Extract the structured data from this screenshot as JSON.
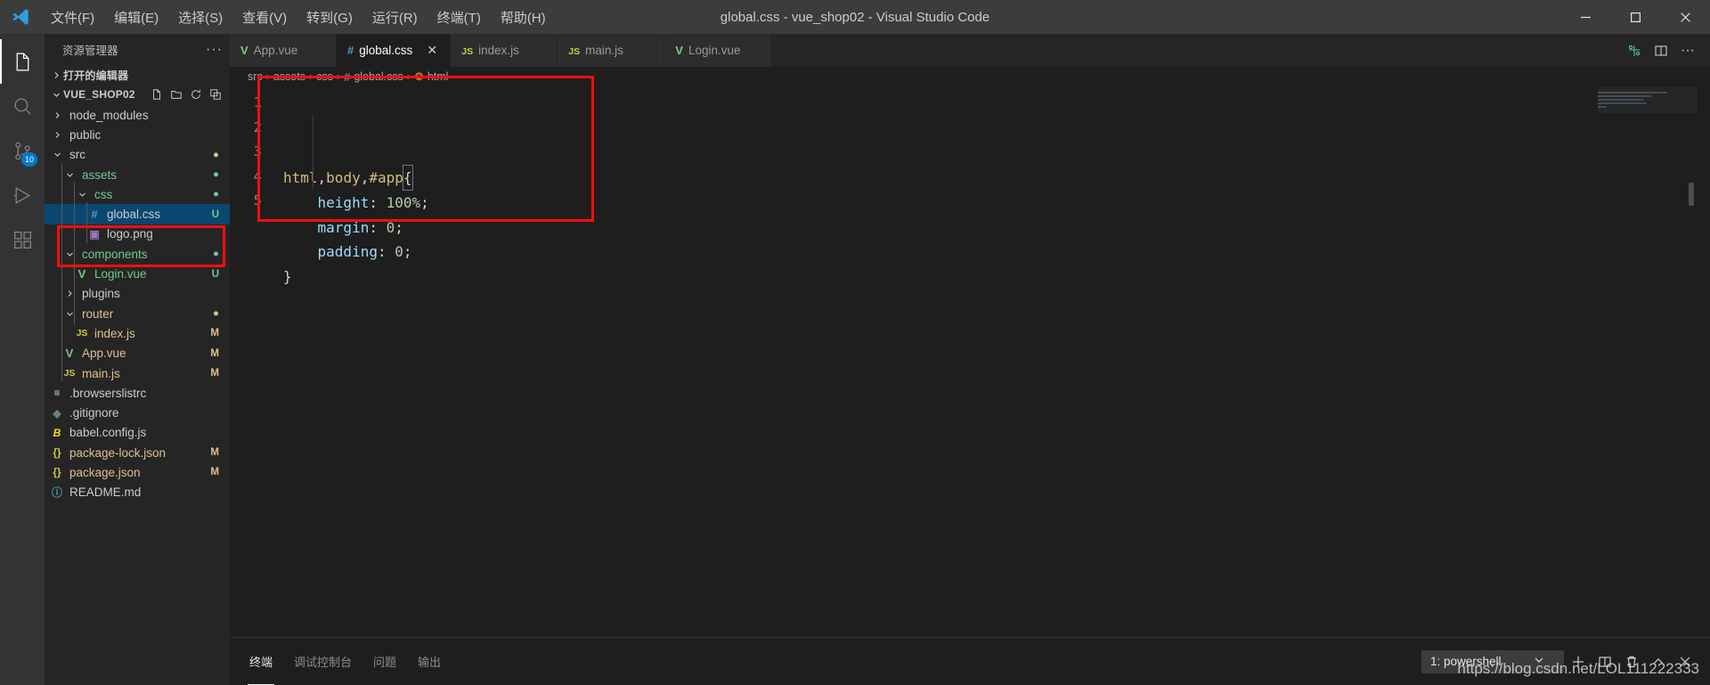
{
  "window": {
    "title": "global.css - vue_shop02 - Visual Studio Code",
    "minimize_label": "−",
    "maximize_label": "□",
    "close_label": "✕"
  },
  "menu": [
    {
      "label": "文件(F)"
    },
    {
      "label": "编辑(E)"
    },
    {
      "label": "选择(S)"
    },
    {
      "label": "查看(V)"
    },
    {
      "label": "转到(G)"
    },
    {
      "label": "运行(R)"
    },
    {
      "label": "终端(T)"
    },
    {
      "label": "帮助(H)"
    }
  ],
  "activitybar": {
    "items": [
      {
        "name": "explorer",
        "icon": "files-icon",
        "active": true,
        "badge": ""
      },
      {
        "name": "search",
        "icon": "search-icon",
        "active": false,
        "badge": ""
      },
      {
        "name": "source-control",
        "icon": "source-control-icon",
        "active": false,
        "badge": "10"
      },
      {
        "name": "run-and-debug",
        "icon": "debug-icon",
        "active": false,
        "badge": ""
      },
      {
        "name": "extensions",
        "icon": "extensions-icon",
        "active": false,
        "badge": ""
      }
    ]
  },
  "sidebar": {
    "title": "资源管理器",
    "more_actions": "···",
    "open_editors_label": "打开的编辑器",
    "project_label": "VUE_SHOP02",
    "folder_actions": [
      "new-file-icon",
      "new-folder-icon",
      "refresh-icon",
      "collapse-all-icon"
    ],
    "tree": [
      {
        "label": "node_modules",
        "icon": "chevron-right",
        "indent": 1,
        "color": "c-folder",
        "badge": "",
        "badge_color": "",
        "selected": false
      },
      {
        "label": "public",
        "icon": "chevron-right",
        "indent": 1,
        "color": "c-folder",
        "badge": "",
        "badge_color": "",
        "selected": false
      },
      {
        "label": "src",
        "icon": "chevron-down",
        "indent": 1,
        "color": "c-folder",
        "badge": "●",
        "badge_color": "c-mod",
        "selected": false
      },
      {
        "label": "assets",
        "icon": "chevron-down",
        "indent": 2,
        "color": "c-green",
        "badge": "●",
        "badge_color": "c-u",
        "selected": false
      },
      {
        "label": "css",
        "icon": "chevron-down",
        "indent": 3,
        "color": "c-green",
        "badge": "●",
        "badge_color": "c-u",
        "selected": false
      },
      {
        "label": "global.css",
        "icon": "hash",
        "indent": 4,
        "color": "c-default",
        "badge": "U",
        "badge_color": "c-u",
        "selected": true
      },
      {
        "label": "logo.png",
        "icon": "image",
        "indent": 4,
        "color": "c-default",
        "badge": "",
        "badge_color": "",
        "selected": false
      },
      {
        "label": "components",
        "icon": "chevron-down",
        "indent": 2,
        "color": "c-green",
        "badge": "●",
        "badge_color": "c-u",
        "selected": false
      },
      {
        "label": "Login.vue",
        "icon": "vue",
        "indent": 3,
        "color": "c-green",
        "badge": "U",
        "badge_color": "c-u",
        "selected": false
      },
      {
        "label": "plugins",
        "icon": "chevron-right",
        "indent": 2,
        "color": "c-folder",
        "badge": "",
        "badge_color": "",
        "selected": false
      },
      {
        "label": "router",
        "icon": "chevron-down",
        "indent": 2,
        "color": "c-orange",
        "badge": "●",
        "badge_color": "c-mod",
        "selected": false
      },
      {
        "label": "index.js",
        "icon": "js",
        "indent": 3,
        "color": "c-orange",
        "badge": "M",
        "badge_color": "c-mod",
        "selected": false
      },
      {
        "label": "App.vue",
        "icon": "vue",
        "indent": 2,
        "color": "c-orange",
        "badge": "M",
        "badge_color": "c-mod",
        "selected": false
      },
      {
        "label": "main.js",
        "icon": "js",
        "indent": 2,
        "color": "c-orange",
        "badge": "M",
        "badge_color": "c-mod",
        "selected": false
      },
      {
        "label": ".browserslistrc",
        "icon": "list",
        "indent": 1,
        "color": "c-default",
        "badge": "",
        "badge_color": "",
        "selected": false
      },
      {
        "label": ".gitignore",
        "icon": "git",
        "indent": 1,
        "color": "c-default",
        "badge": "",
        "badge_color": "",
        "selected": false
      },
      {
        "label": "babel.config.js",
        "icon": "babel",
        "indent": 1,
        "color": "c-default",
        "badge": "",
        "badge_color": "",
        "selected": false
      },
      {
        "label": "package-lock.json",
        "icon": "json",
        "indent": 1,
        "color": "c-orange",
        "badge": "M",
        "badge_color": "c-mod",
        "selected": false
      },
      {
        "label": "package.json",
        "icon": "json",
        "indent": 1,
        "color": "c-orange",
        "badge": "M",
        "badge_color": "c-mod",
        "selected": false
      },
      {
        "label": "README.md",
        "icon": "info",
        "indent": 1,
        "color": "c-default",
        "badge": "",
        "badge_color": "",
        "selected": false
      }
    ]
  },
  "editor": {
    "tabs": [
      {
        "label": "App.vue",
        "icon": "vue",
        "active": false,
        "closable": false
      },
      {
        "label": "global.css",
        "icon": "hash",
        "active": true,
        "closable": true
      },
      {
        "label": "index.js",
        "icon": "js",
        "active": false,
        "closable": false
      },
      {
        "label": "main.js",
        "icon": "js",
        "active": false,
        "closable": false
      },
      {
        "label": "Login.vue",
        "icon": "vue",
        "active": false,
        "closable": false
      }
    ],
    "tab_close_label": "✕",
    "tab_actions": [
      "split-editor-icon",
      "layout-icon",
      "more-actions-icon"
    ],
    "breadcrumb": [
      {
        "label": "src",
        "icon": ""
      },
      {
        "label": "assets",
        "icon": ""
      },
      {
        "label": "css",
        "icon": ""
      },
      {
        "label": "global.css",
        "icon": "hash"
      },
      {
        "label": "html",
        "icon": "css-rule"
      }
    ],
    "breadcrumb_separator": "›",
    "line_numbers": [
      "1",
      "2",
      "3",
      "4",
      "5"
    ],
    "code_lines": [
      {
        "segments": [
          {
            "text": "html",
            "cls": "k-tag"
          },
          {
            "text": ",",
            "cls": "k-punc"
          },
          {
            "text": "body",
            "cls": "k-tag"
          },
          {
            "text": ",",
            "cls": "k-punc"
          },
          {
            "text": "#app",
            "cls": "k-tag"
          },
          {
            "text": "{",
            "cls": "k-brace cursor-box"
          }
        ]
      },
      {
        "segments": [
          {
            "text": "    ",
            "cls": "k-punc"
          },
          {
            "text": "height",
            "cls": "k-prop"
          },
          {
            "text": ": ",
            "cls": "k-punc"
          },
          {
            "text": "100%",
            "cls": "k-val"
          },
          {
            "text": ";",
            "cls": "k-punc"
          }
        ]
      },
      {
        "segments": [
          {
            "text": "    ",
            "cls": "k-punc"
          },
          {
            "text": "margin",
            "cls": "k-prop"
          },
          {
            "text": ": ",
            "cls": "k-punc"
          },
          {
            "text": "0",
            "cls": "k-val"
          },
          {
            "text": ";",
            "cls": "k-punc"
          }
        ]
      },
      {
        "segments": [
          {
            "text": "    ",
            "cls": "k-punc"
          },
          {
            "text": "padding",
            "cls": "k-prop"
          },
          {
            "text": ": ",
            "cls": "k-punc"
          },
          {
            "text": "0",
            "cls": "k-val"
          },
          {
            "text": ";",
            "cls": "k-punc"
          }
        ]
      },
      {
        "segments": [
          {
            "text": "}",
            "cls": "k-brace"
          }
        ]
      }
    ]
  },
  "panel": {
    "tabs": [
      {
        "label": "终端",
        "active": true
      },
      {
        "label": "调试控制台",
        "active": false
      },
      {
        "label": "问题",
        "active": false
      },
      {
        "label": "输出",
        "active": false
      }
    ],
    "terminal_selected": "1: powershell",
    "actions": [
      "new-terminal-icon",
      "split-terminal-icon",
      "kill-terminal-icon",
      "chevron-up-icon",
      "close-icon"
    ]
  },
  "watermark": "https://blog.csdn.net/LOL111222333",
  "colors": {
    "accent": "#007acc",
    "selection": "#094771",
    "annotation": "#fb0d0d",
    "modified": "#e2c08d",
    "untracked": "#73c991"
  }
}
